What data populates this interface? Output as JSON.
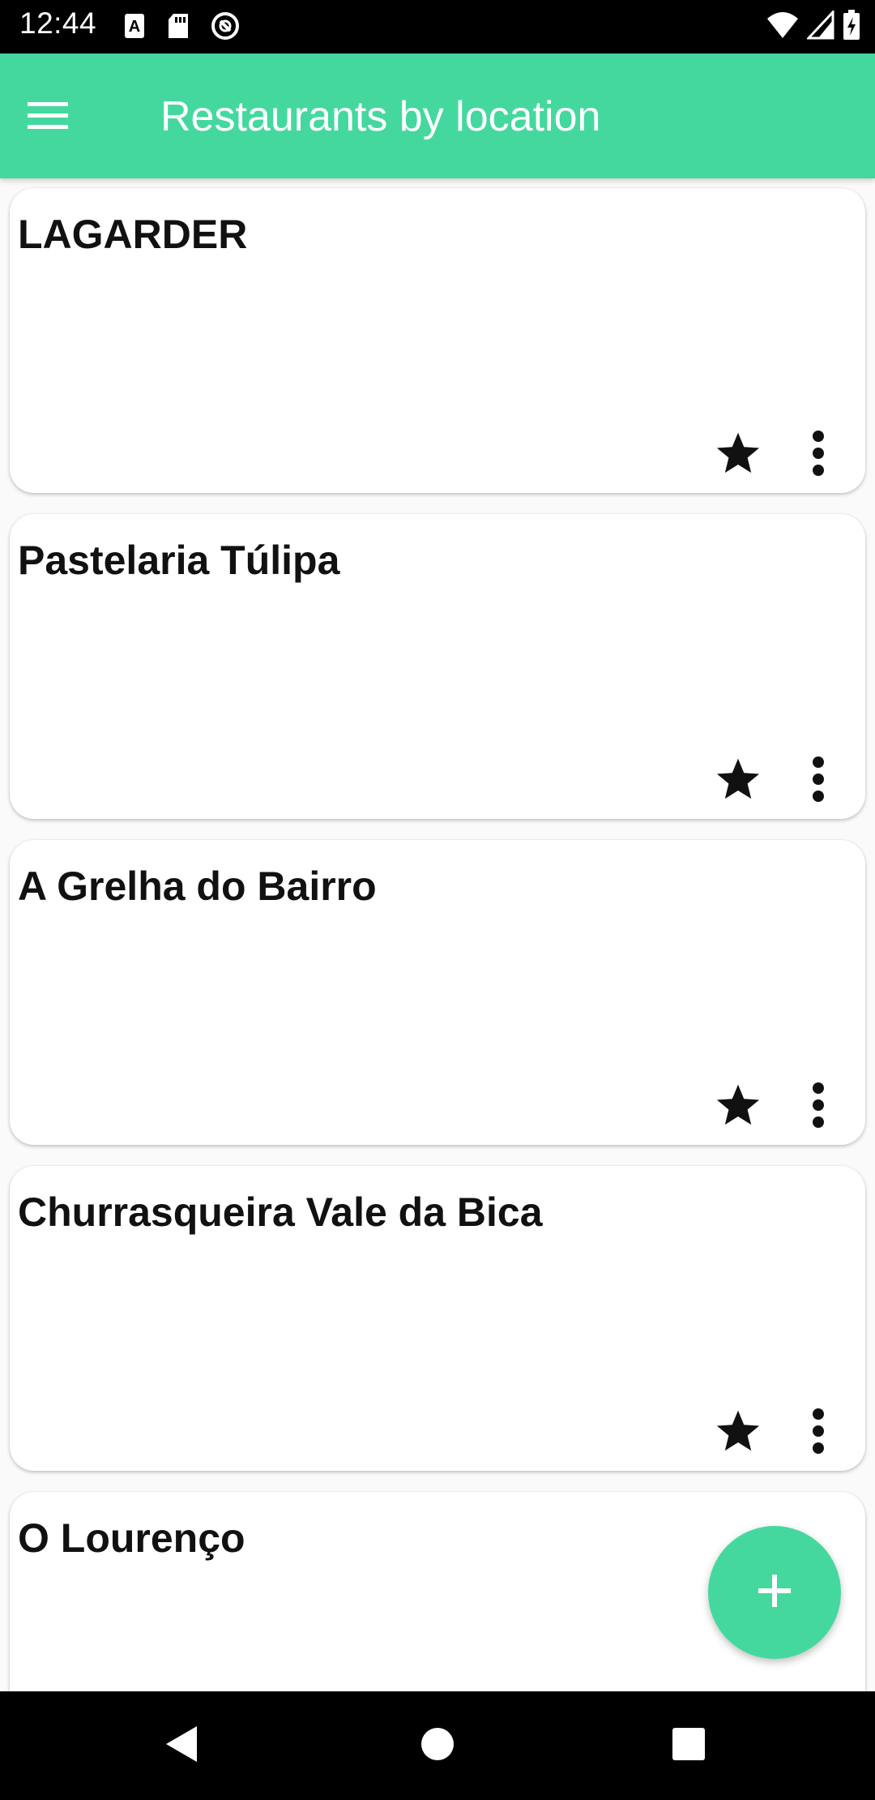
{
  "status_bar": {
    "time": "12:44",
    "left_icons": [
      "font-a-icon",
      "sd-card-icon",
      "sync-circle-icon"
    ],
    "right_icons": [
      "wifi-icon",
      "cell-signal-icon",
      "battery-charging-icon"
    ]
  },
  "app_bar": {
    "menu_icon": "hamburger-menu-icon",
    "title": "Restaurants by location",
    "color": "#44d89f"
  },
  "restaurants": [
    {
      "name": "LAGARDER"
    },
    {
      "name": "Pastelaria Túlipa"
    },
    {
      "name": "A Grelha do Bairro"
    },
    {
      "name": "Churrasqueira Vale da Bica"
    },
    {
      "name": "O Lourenço"
    }
  ],
  "card_actions": {
    "favorite_icon": "star-icon",
    "more_icon": "more-vertical-icon"
  },
  "fab": {
    "icon": "plus-icon",
    "color": "#44d89f"
  },
  "nav_bar": {
    "items": [
      "back-triangle-icon",
      "home-circle-icon",
      "recents-square-icon"
    ]
  }
}
